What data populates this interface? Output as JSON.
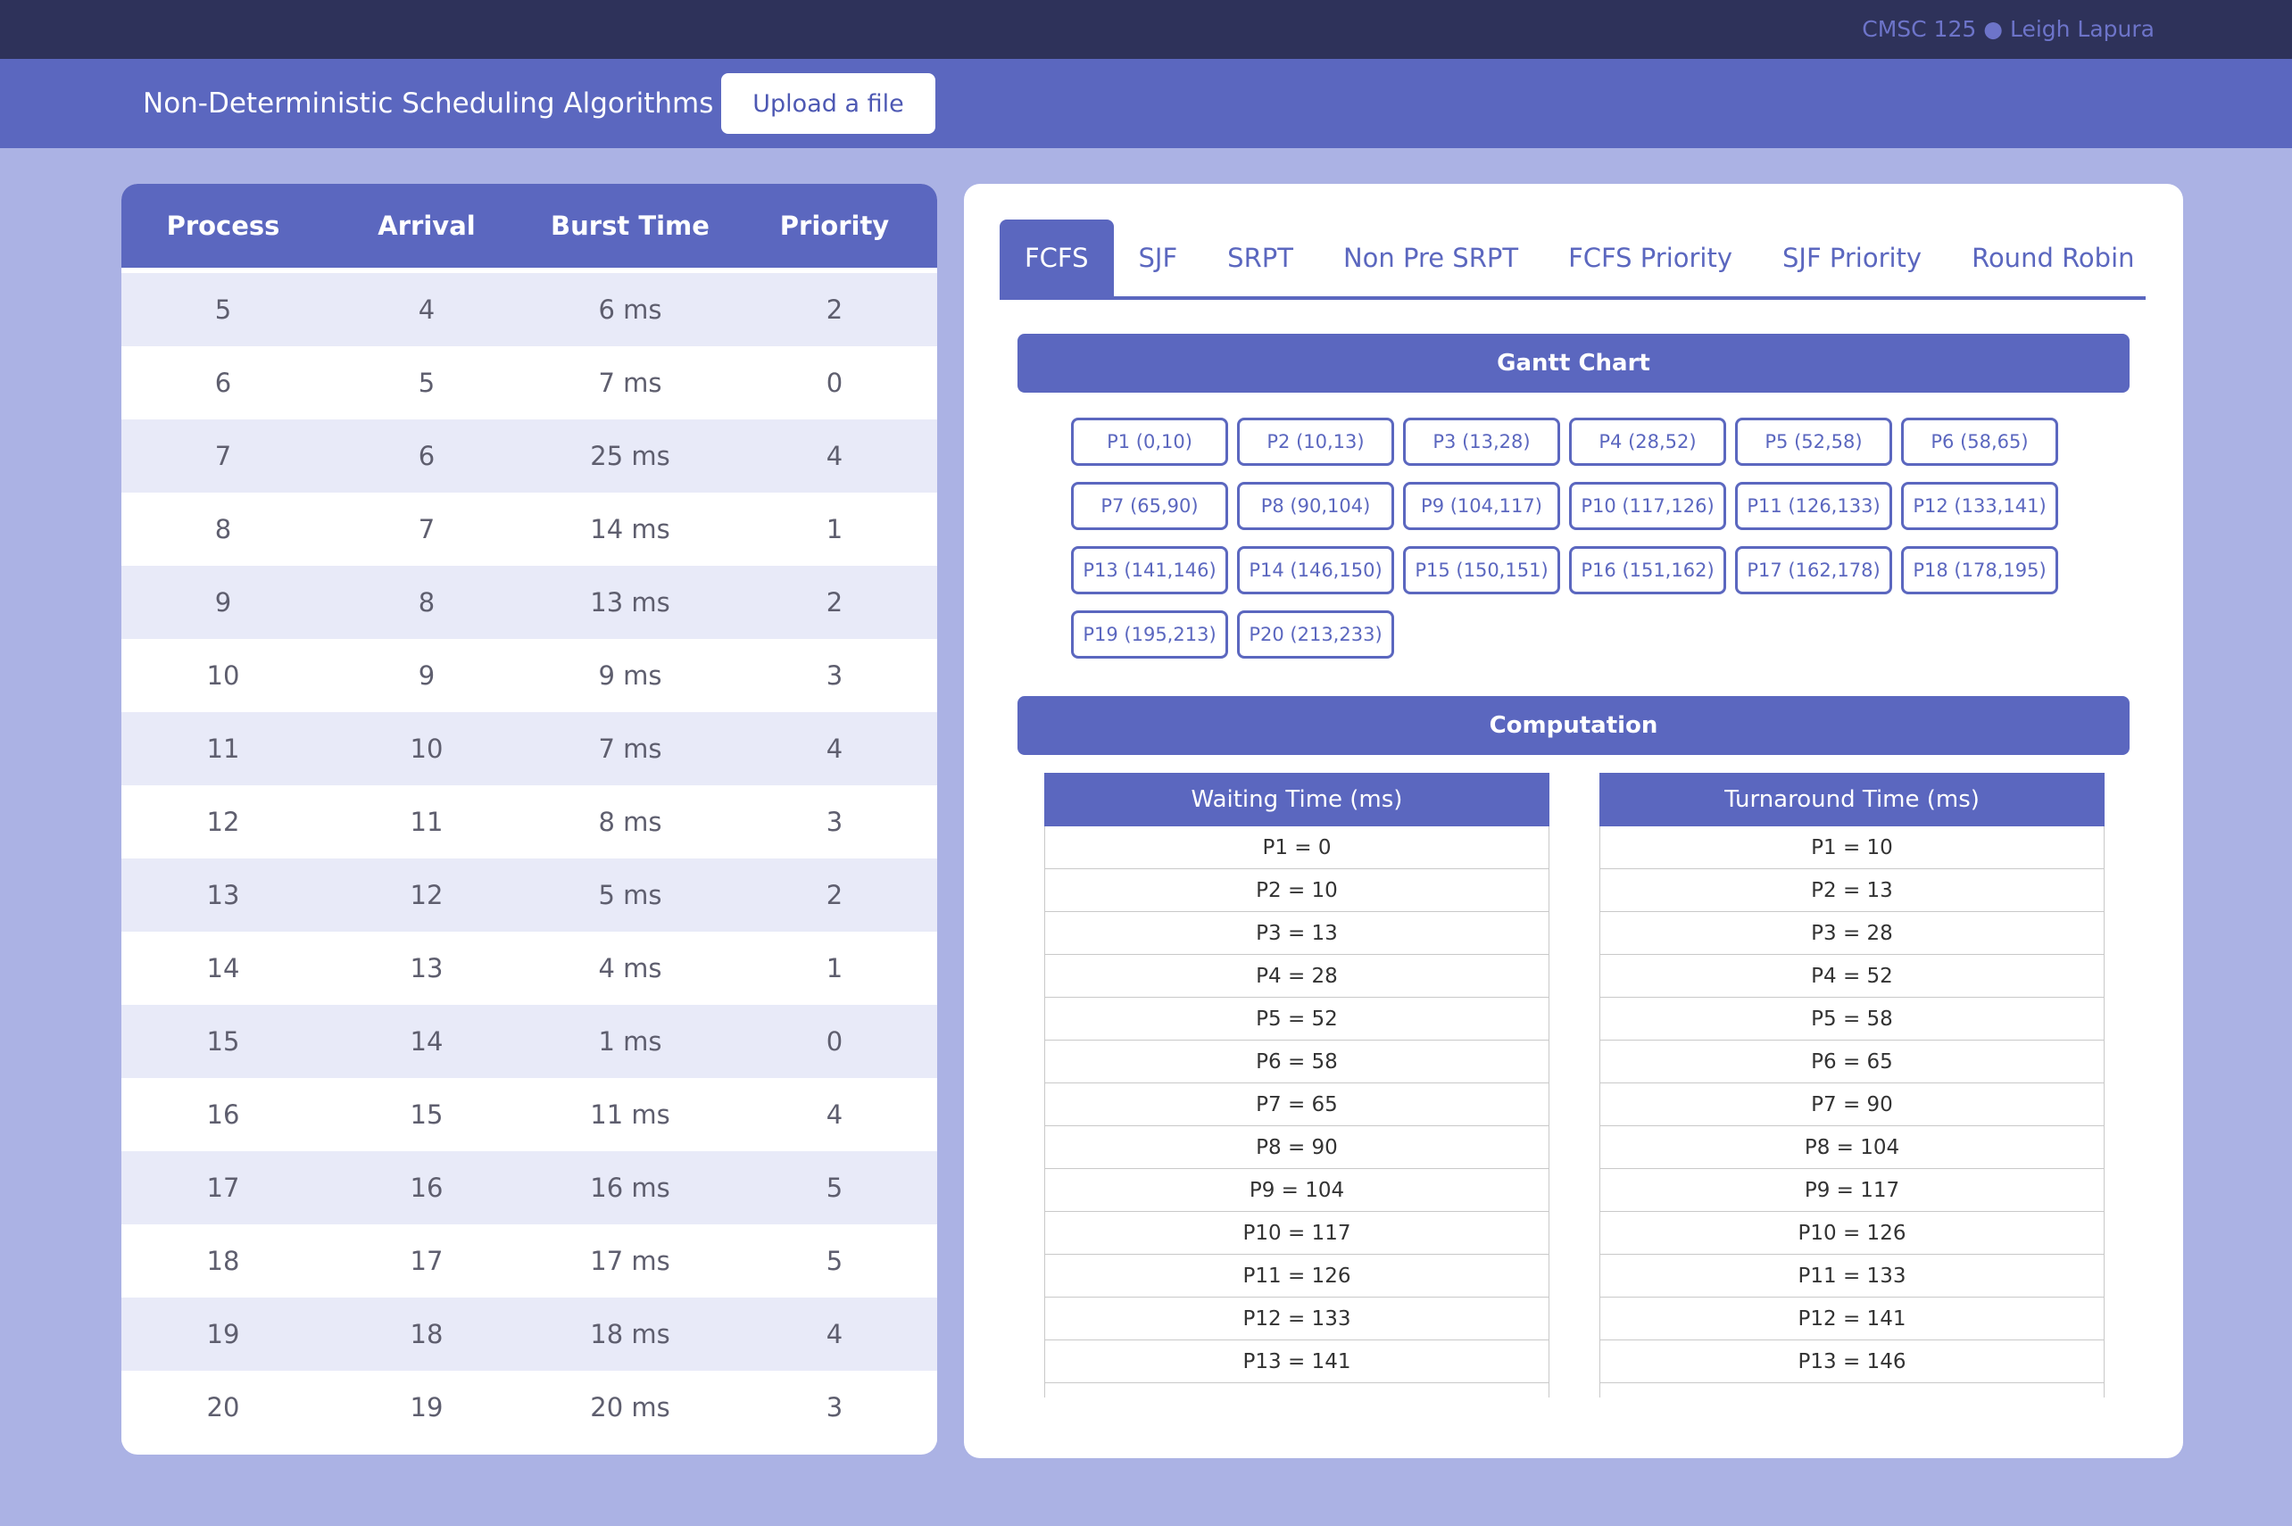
{
  "topbar": {
    "credit": "CMSC 125 ● Leigh Lapura"
  },
  "appbar": {
    "title": "Non-Deterministic Scheduling Algorithms",
    "upload_label": "Upload a file"
  },
  "process_table": {
    "headers": [
      "Process",
      "Arrival",
      "Burst Time",
      "Priority"
    ],
    "rows": [
      [
        "5",
        "4",
        "6 ms",
        "2"
      ],
      [
        "6",
        "5",
        "7 ms",
        "0"
      ],
      [
        "7",
        "6",
        "25 ms",
        "4"
      ],
      [
        "8",
        "7",
        "14 ms",
        "1"
      ],
      [
        "9",
        "8",
        "13 ms",
        "2"
      ],
      [
        "10",
        "9",
        "9 ms",
        "3"
      ],
      [
        "11",
        "10",
        "7 ms",
        "4"
      ],
      [
        "12",
        "11",
        "8 ms",
        "3"
      ],
      [
        "13",
        "12",
        "5 ms",
        "2"
      ],
      [
        "14",
        "13",
        "4 ms",
        "1"
      ],
      [
        "15",
        "14",
        "1 ms",
        "0"
      ],
      [
        "16",
        "15",
        "11 ms",
        "4"
      ],
      [
        "17",
        "16",
        "16 ms",
        "5"
      ],
      [
        "18",
        "17",
        "17 ms",
        "5"
      ],
      [
        "19",
        "18",
        "18 ms",
        "4"
      ],
      [
        "20",
        "19",
        "20 ms",
        "3"
      ]
    ]
  },
  "tabs": [
    {
      "label": "FCFS",
      "active": true
    },
    {
      "label": "SJF",
      "active": false
    },
    {
      "label": "SRPT",
      "active": false
    },
    {
      "label": "Non Pre SRPT",
      "active": false
    },
    {
      "label": "FCFS Priority",
      "active": false
    },
    {
      "label": "SJF Priority",
      "active": false
    },
    {
      "label": "Round Robin",
      "active": false
    }
  ],
  "gantt": {
    "title": "Gantt Chart",
    "items": [
      "P1 (0,10)",
      "P2 (10,13)",
      "P3 (13,28)",
      "P4 (28,52)",
      "P5 (52,58)",
      "P6 (58,65)",
      "P7 (65,90)",
      "P8 (90,104)",
      "P9 (104,117)",
      "P10 (117,126)",
      "P11 (126,133)",
      "P12 (133,141)",
      "P13 (141,146)",
      "P14 (146,150)",
      "P15 (150,151)",
      "P16 (151,162)",
      "P17 (162,178)",
      "P18 (178,195)",
      "P19 (195,213)",
      "P20 (213,233)"
    ]
  },
  "computation": {
    "title": "Computation",
    "waiting": {
      "header": "Waiting Time (ms)",
      "rows": [
        "P1 = 0",
        "P2 = 10",
        "P3 = 13",
        "P4 = 28",
        "P5 = 52",
        "P6 = 58",
        "P7 = 65",
        "P8 = 90",
        "P9 = 104",
        "P10 = 117",
        "P11 = 126",
        "P12 = 133",
        "P13 = 141"
      ]
    },
    "turnaround": {
      "header": "Turnaround Time (ms)",
      "rows": [
        "P1 = 10",
        "P2 = 13",
        "P3 = 28",
        "P4 = 52",
        "P5 = 58",
        "P6 = 65",
        "P7 = 90",
        "P8 = 104",
        "P9 = 117",
        "P10 = 126",
        "P11 = 133",
        "P12 = 141",
        "P13 = 146"
      ]
    }
  }
}
